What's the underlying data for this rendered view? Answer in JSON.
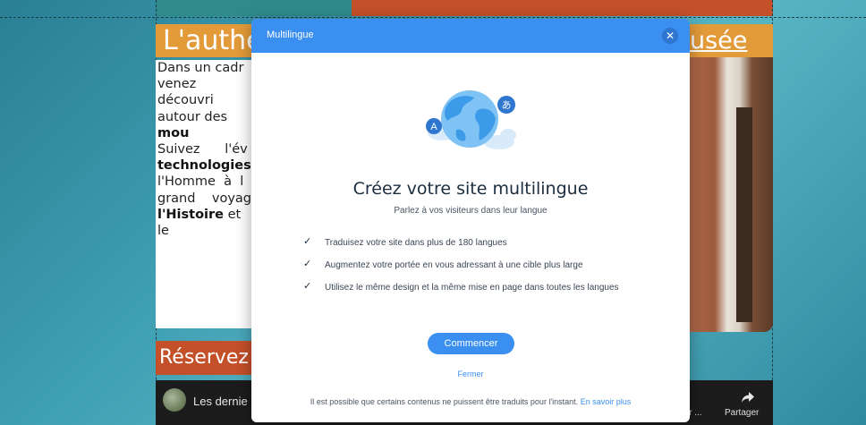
{
  "background_page": {
    "title_left": "L'authe",
    "title_right": "usée",
    "body_lines": [
      {
        "text": "Dans un cadr",
        "bold": false
      },
      {
        "text": "venez découvri",
        "bold": false
      },
      {
        "text": "autour des ",
        "bold": false,
        "bold_tail": "mou"
      },
      {
        "text": "Suivez      l'év",
        "bold": false
      },
      {
        "text": "technologies,",
        "bold": true
      },
      {
        "text": "l'Homme  à  l",
        "bold": false
      },
      {
        "text": "grand    voyag",
        "bold": false
      },
      {
        "text": "l'Histoire",
        "bold": true,
        "tail": " et le"
      }
    ],
    "reserve_label": "Réservez v",
    "video_title": "Les dernie",
    "video_watch_label": "der ...",
    "video_share_label": "Partager"
  },
  "modal": {
    "header_title": "Multilingue",
    "close_symbol": "✕",
    "heading": "Créez votre site multilingue",
    "subtitle": "Parlez à vos visiteurs dans leur langue",
    "features": [
      "Traduisez votre site dans plus de 180 langues",
      "Augmentez votre portée en vous adressant à une cible plus large",
      "Utilisez le même design et la même mise en page dans toutes les langues"
    ],
    "check_symbol": "✓",
    "start_button_label": "Commencer",
    "close_link_label": "Fermer",
    "footer_text": "Il est possible que certains contenus ne puissent être traduits pour l'instant.",
    "footer_link_label": "En savoir plus",
    "illustration": {
      "badge_left_letter": "A",
      "badge_right_letter": "あ",
      "icon_name": "globe-language-icon"
    }
  },
  "colors": {
    "modal_accent": "#3b8ff0",
    "title_bar_orange": "#e39b3a",
    "reserve_bar": "#c4502a",
    "teal_background": "#3f9fb3"
  }
}
